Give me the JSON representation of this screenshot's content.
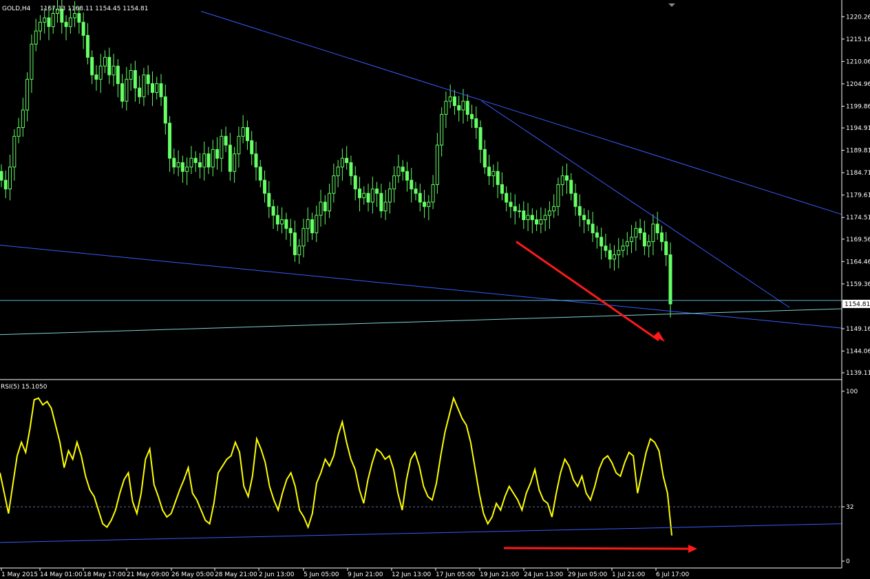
{
  "chart_data": {
    "type": "candlestick",
    "symbol_title": "GOLD,H4",
    "ohlc_label": "1167.33 1168.11 1154.45 1154.81",
    "current_price_label": "1154.81",
    "price_ticks": [
      "1220.26",
      "1215.16",
      "1210.06",
      "1204.96",
      "1199.86",
      "1194.91",
      "1189.81",
      "1184.71",
      "1179.61",
      "1174.51",
      "1169.56",
      "1164.46",
      "1159.36",
      "1149.16",
      "1144.06",
      "1139.11"
    ],
    "price_ylim": [
      1138.5,
      1222.5
    ],
    "time_labels": [
      "1 May 2015",
      "14 May 01:00",
      "18 May 17:00",
      "21 May 09:00",
      "26 May 05:00",
      "28 May 21:00",
      "2 Jun 13:00",
      "5 Jun 05:00",
      "9 Jun 21:00",
      "12 Jun 13:00",
      "17 Jun 05:00",
      "19 Jun 21:00",
      "24 Jun 13:00",
      "29 Jun 05:00",
      "1 Jul 21:00",
      "6 Jul 17:00"
    ],
    "closes": [
      1183,
      1181,
      1186,
      1193,
      1195,
      1199,
      1206,
      1214,
      1217,
      1219,
      1220,
      1218,
      1221,
      1222,
      1219,
      1218,
      1220,
      1221,
      1219,
      1216,
      1211,
      1207,
      1206,
      1209,
      1211,
      1207,
      1209,
      1205,
      1201,
      1206,
      1208,
      1204,
      1202,
      1207,
      1205,
      1203,
      1205,
      1202,
      1196,
      1188,
      1186,
      1187,
      1185,
      1186,
      1188,
      1187,
      1186,
      1189,
      1186,
      1190,
      1188,
      1193,
      1191,
      1185,
      1189,
      1193,
      1195,
      1192,
      1189,
      1186,
      1183,
      1180,
      1177,
      1175,
      1173,
      1174,
      1172,
      1171,
      1166,
      1168,
      1172,
      1174,
      1171,
      1175,
      1178,
      1176,
      1180,
      1184,
      1186,
      1188,
      1187,
      1184,
      1181,
      1179,
      1180,
      1178,
      1181,
      1180,
      1176,
      1178,
      1181,
      1184,
      1186,
      1185,
      1183,
      1181,
      1180,
      1178,
      1177,
      1178,
      1182,
      1191,
      1198,
      1201,
      1202,
      1200,
      1199,
      1201,
      1198,
      1197,
      1195,
      1190,
      1186,
      1184,
      1185,
      1182,
      1180,
      1178,
      1177,
      1176,
      1176,
      1174,
      1175,
      1174,
      1173,
      1174,
      1175,
      1176,
      1177,
      1182,
      1184,
      1183,
      1180,
      1177,
      1175,
      1174,
      1173,
      1171,
      1170,
      1168,
      1167,
      1165,
      1166,
      1167,
      1168,
      1169,
      1170,
      1172,
      1171,
      1168,
      1169,
      1173,
      1171,
      1169,
      1166,
      1154.81
    ],
    "rsi_label": "RSI(5) 15.1050",
    "rsi_ticks": [
      "100",
      "32",
      "0"
    ],
    "rsi_level": 32,
    "rsi_values": [
      52,
      40,
      28,
      45,
      62,
      70,
      64,
      78,
      95,
      96,
      92,
      94,
      90,
      80,
      70,
      55,
      65,
      60,
      70,
      62,
      50,
      42,
      38,
      30,
      22,
      20,
      24,
      30,
      40,
      48,
      52,
      35,
      28,
      40,
      60,
      66,
      45,
      38,
      30,
      26,
      28,
      35,
      42,
      48,
      55,
      40,
      36,
      30,
      24,
      22,
      34,
      52,
      56,
      60,
      62,
      70,
      64,
      44,
      38,
      50,
      72,
      66,
      58,
      44,
      36,
      30,
      40,
      48,
      52,
      44,
      30,
      26,
      20,
      28,
      46,
      52,
      60,
      56,
      62,
      74,
      82,
      70,
      60,
      54,
      42,
      34,
      48,
      58,
      66,
      64,
      60,
      62,
      54,
      40,
      30,
      48,
      60,
      64,
      56,
      44,
      38,
      36,
      46,
      62,
      76,
      86,
      96,
      90,
      84,
      80,
      70,
      55,
      40,
      28,
      22,
      26,
      34,
      30,
      38,
      44,
      40,
      36,
      30,
      40,
      46,
      54,
      42,
      36,
      34,
      26,
      40,
      52,
      60,
      56,
      48,
      44,
      50,
      40,
      36,
      44,
      54,
      60,
      62,
      58,
      52,
      50,
      58,
      64,
      62,
      40,
      52,
      64,
      72,
      70,
      65,
      50,
      40,
      15.1
    ],
    "ann_text": ""
  }
}
